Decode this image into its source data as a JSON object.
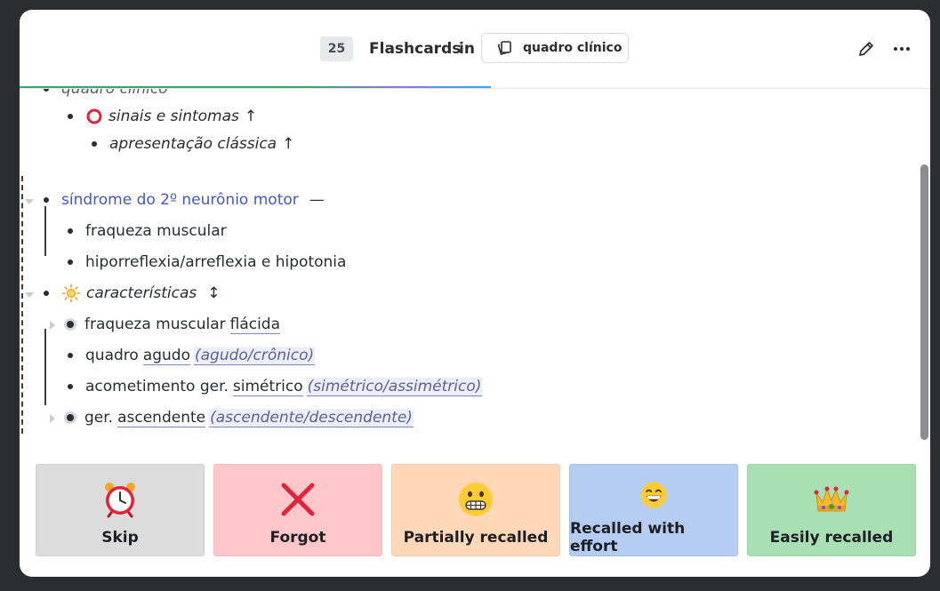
{
  "header": {
    "count": "25",
    "title": "Flashcards",
    "in_word": "in",
    "deck_chip": "quadro clínico",
    "icons": [
      "pencil-icon",
      "more-horizontal-icon",
      "cards-icon"
    ]
  },
  "content": {
    "cut_top_line": "quadro clínico",
    "l1": "sinais e sintomas",
    "l1_arrow": "↑",
    "l2": "apresentação clássica",
    "l2_arrow": "↑",
    "s_title": "síndrome do 2º neurônio motor",
    "s_dash": "—",
    "s_item1": "fraqueza muscular",
    "s_item2": "hiporreflexia/arreflexia e hipotonia",
    "c_title": "características",
    "c_arrow": "↕",
    "c1_text": "fraqueza muscular",
    "c1_cloze": "flácida",
    "c2_text": "quadro",
    "c2_cloze": "agudo",
    "c2_hint": "(agudo/crônico)",
    "c3_text": "acometimento ger.",
    "c3_cloze": "simétrico",
    "c3_hint": "(simétrico/assimétrico)",
    "c4_text": "ger.",
    "c4_cloze": "ascendente",
    "c4_hint": "(ascendente/descendente)"
  },
  "buttons": [
    {
      "label": "Skip",
      "color": "#dcdcdc",
      "icon": "alarm-clock-icon"
    },
    {
      "label": "Forgot",
      "color": "#ffc7c9",
      "icon": "cross-mark-icon"
    },
    {
      "label": "Partially recalled",
      "color": "#fed8b8",
      "icon": "grimacing-face-icon"
    },
    {
      "label": "Recalled with effort",
      "color": "#b5cdf0",
      "icon": "grinning-face-icon"
    },
    {
      "label": "Easily recalled",
      "color": "#a8e0b4",
      "icon": "crown-icon"
    }
  ]
}
